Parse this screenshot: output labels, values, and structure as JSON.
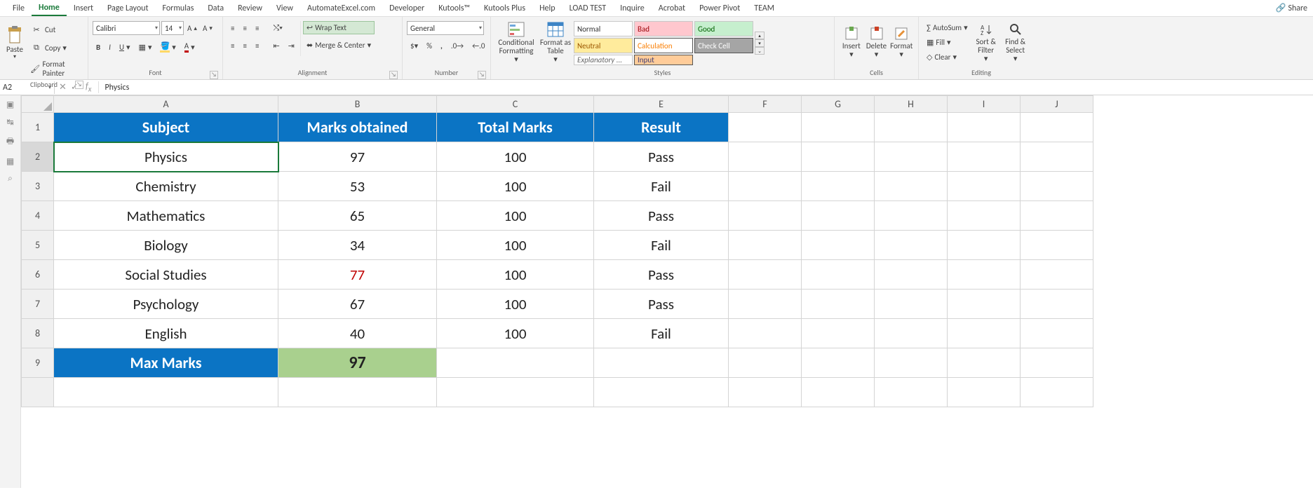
{
  "menu": {
    "items": [
      "File",
      "Home",
      "Insert",
      "Page Layout",
      "Formulas",
      "Data",
      "Review",
      "View",
      "AutomateExcel.com",
      "Developer",
      "Kutools™",
      "Kutools Plus",
      "Help",
      "LOAD TEST",
      "Inquire",
      "Acrobat",
      "Power Pivot",
      "TEAM"
    ],
    "active": 1,
    "share": "Share"
  },
  "clipboard": {
    "paste": "Paste",
    "cut": "Cut",
    "copy": "Copy",
    "fmtpaint": "Format Painter",
    "label": "Clipboard"
  },
  "font": {
    "name": "Calibri",
    "size": "14",
    "label": "Font"
  },
  "alignment": {
    "wrap": "Wrap Text",
    "merge": "Merge & Center",
    "label": "Alignment"
  },
  "number": {
    "fmt": "General",
    "label": "Number"
  },
  "styles": {
    "cond": "Conditional Formatting",
    "table": "Format as Table",
    "cells": [
      "Normal",
      "Bad",
      "Good",
      "Neutral",
      "Calculation",
      "Check Cell",
      "Explanatory ...",
      "Input"
    ],
    "label": "Styles"
  },
  "cells": {
    "insert": "Insert",
    "delete": "Delete",
    "format": "Format",
    "label": "Cells"
  },
  "editing": {
    "sum": "AutoSum",
    "fill": "Fill",
    "clear": "Clear",
    "sort": "Sort & Filter",
    "find": "Find & Select",
    "label": "Editing"
  },
  "namebox": "A2",
  "formula": "Physics",
  "columns": [
    "A",
    "B",
    "C",
    "E",
    "F",
    "G",
    "H",
    "I",
    "J"
  ],
  "rows": [
    "1",
    "2",
    "3",
    "4",
    "5",
    "6",
    "7",
    "8",
    "9"
  ],
  "headers": [
    "Subject",
    "Marks obtained",
    "Total Marks",
    "Result"
  ],
  "data": [
    [
      "Physics",
      "97",
      "100",
      "Pass"
    ],
    [
      "Chemistry",
      "53",
      "100",
      "Fail"
    ],
    [
      "Mathematics",
      "65",
      "100",
      "Pass"
    ],
    [
      "Biology",
      "34",
      "100",
      "Fail"
    ],
    [
      "Social Studies",
      "77",
      "100",
      "Pass"
    ],
    [
      "Psychology",
      "67",
      "100",
      "Pass"
    ],
    [
      "English",
      "40",
      "100",
      "Fail"
    ]
  ],
  "maxrow": {
    "label": "Max Marks",
    "value": "97"
  }
}
